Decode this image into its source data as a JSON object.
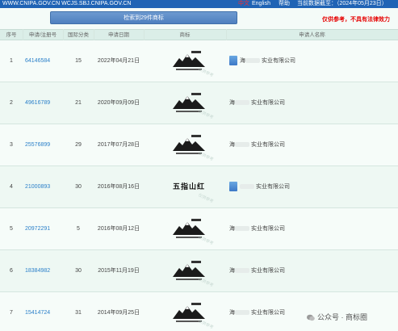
{
  "topbar": {
    "site": "WWW.CNIPA.GOV.CN WCJS.SBJ.CNIPA.GOV.CN",
    "lang_cn": "中文",
    "lang_en": "English",
    "help": "帮助",
    "deadline": "当前数据截至：（2024年05月23日）"
  },
  "search": {
    "result_button": "检索到29件商标",
    "notice": "仅供参考，不具有法律效力"
  },
  "table": {
    "headers": [
      "序号",
      "申请/注册号",
      "国际分类",
      "申请日期",
      "商标",
      "申请人名称"
    ],
    "rows": [
      {
        "index": "1",
        "reg_no": "64146584",
        "class": "15",
        "date": "2022年04月21日",
        "applicant_prefix": "海",
        "applicant_suffix": "实业有限公司",
        "logo": "mountain-logo"
      },
      {
        "index": "2",
        "reg_no": "49616789",
        "class": "21",
        "date": "2020年09月09日",
        "applicant_prefix": "海",
        "applicant_suffix": "实业有限公司",
        "logo": "mountain-logo"
      },
      {
        "index": "3",
        "reg_no": "25576899",
        "class": "29",
        "date": "2017年07月28日",
        "applicant_prefix": "海",
        "applicant_suffix": "实业有限公司",
        "logo": "mountain-logo"
      },
      {
        "index": "4",
        "reg_no": "21000893",
        "class": "30",
        "date": "2016年08月16日",
        "applicant_prefix": "",
        "applicant_suffix": "实业有限公司",
        "logo_text": "五指山红"
      },
      {
        "index": "5",
        "reg_no": "20972291",
        "class": "5",
        "date": "2016年08月12日",
        "applicant_prefix": "海",
        "applicant_suffix": "实业有限公司",
        "logo": "mountain-logo"
      },
      {
        "index": "6",
        "reg_no": "18384982",
        "class": "30",
        "date": "2015年11月19日",
        "applicant_prefix": "海",
        "applicant_suffix": "实业有限公司",
        "logo": "mountain-logo"
      },
      {
        "index": "7",
        "reg_no": "15414724",
        "class": "31",
        "date": "2014年09月25日",
        "applicant_prefix": "海",
        "applicant_suffix": "实业有限公司",
        "logo": "mountain-logo"
      }
    ]
  },
  "watermark_text": "仅供参考",
  "wechat": {
    "label": "公众号 · 商标圈"
  },
  "colors": {
    "topbar": "#1f63b5",
    "link": "#2a7fc9",
    "notice": "#e60000"
  }
}
